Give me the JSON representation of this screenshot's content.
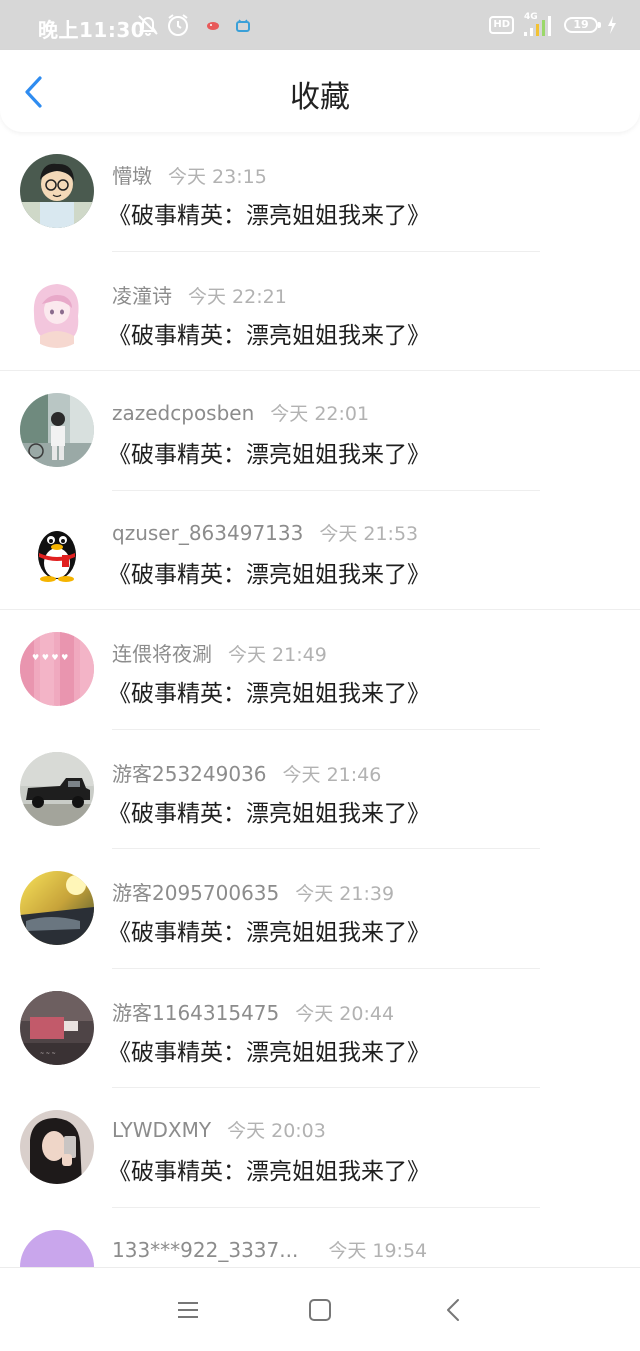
{
  "status_bar": {
    "time": "晚上11:30",
    "hd": "HD",
    "network": "4G",
    "battery": "19"
  },
  "header": {
    "title": "收藏"
  },
  "items": [
    {
      "name": "懵墩",
      "time": "今天 23:15",
      "content": "《破事精英：漂亮姐姐我来了》",
      "avatar": "cartoon-boy-avatar"
    },
    {
      "name": "凌潼诗",
      "time": "今天 22:21",
      "content": "《破事精英：漂亮姐姐我来了》",
      "avatar": "anime-girl-avatar"
    },
    {
      "name": "zazedcposben",
      "time": "今天 22:01",
      "content": "《破事精英：漂亮姐姐我来了》",
      "avatar": "street-photo-avatar"
    },
    {
      "name": "qzuser_863497133",
      "time": "今天 21:53",
      "content": "《破事精英：漂亮姐姐我来了》",
      "avatar": "qq-penguin-avatar"
    },
    {
      "name": "连偎将夜涮",
      "time": "今天 21:49",
      "content": "《破事精英：漂亮姐姐我来了》",
      "avatar": "pink-curtain-avatar"
    },
    {
      "name": "游客253249036",
      "time": "今天 21:46",
      "content": "《破事精英：漂亮姐姐我来了》",
      "avatar": "vintage-car-avatar"
    },
    {
      "name": "游客2095700635",
      "time": "今天 21:39",
      "content": "《破事精英：漂亮姐姐我来了》",
      "avatar": "sunset-car-avatar"
    },
    {
      "name": "游客1164315475",
      "time": "今天 20:44",
      "content": "《破事精英：漂亮姐姐我来了》",
      "avatar": "dark-room-avatar"
    },
    {
      "name": "LYWDXMY",
      "time": "今天 20:03",
      "content": "《破事精英：漂亮姐姐我来了》",
      "avatar": "selfie-girl-avatar"
    },
    {
      "name": "133***922_3337...",
      "time": "今天 19:54",
      "content": "",
      "avatar": "purple-game-avatar"
    }
  ],
  "colors": {
    "accent": "#2f8cf0",
    "status_bar_bg": "#d7d7d7",
    "name_text": "#8c8c8c",
    "content_text": "#1f1f1f"
  }
}
